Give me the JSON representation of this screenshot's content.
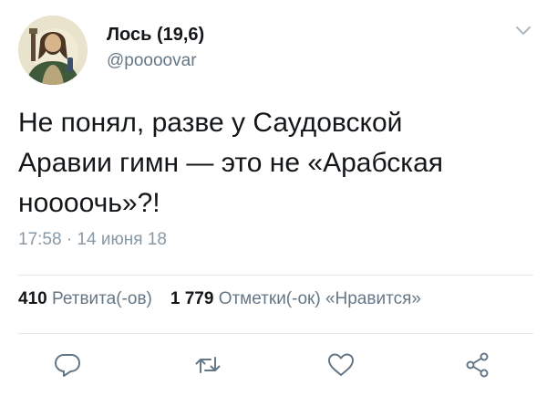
{
  "tweet": {
    "author_name": "Лось (19,6)",
    "handle": "@poooovar",
    "text": "Не понял, разве у Саудовской\nАравии гимн — это не «Арабская\nноооочь»?!",
    "timestamp": "17:58 · 14 июня 18"
  },
  "stats": {
    "retweets_count": "410",
    "retweets_label": "Ретвита(-ов)",
    "likes_count": "1 779",
    "likes_label": "Отметки(-ок) «Нравится»"
  },
  "icons": {
    "menu": "chevron-down-icon",
    "reply": "reply-icon",
    "retweet": "retweet-icon",
    "like": "heart-icon",
    "share": "share-icon"
  },
  "colors": {
    "text": "#14171a",
    "secondary": "#657786",
    "timestamp": "#8899a6",
    "divider": "#e1e8ed"
  }
}
